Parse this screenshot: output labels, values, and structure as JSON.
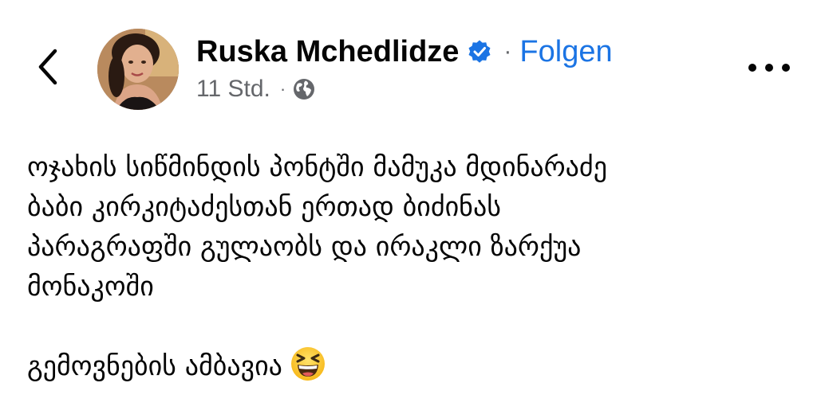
{
  "header": {
    "back_icon": "chevron-left-icon",
    "author_name": "Ruska Mchedlidze",
    "verified_icon": "verified-badge-icon",
    "separator": "·",
    "follow_label": "Folgen",
    "timestamp": "11 Std.",
    "meta_separator": "·",
    "audience_icon": "globe-icon",
    "more_icon": "more-options-icon"
  },
  "post": {
    "lines": [
      "ოჯახის სიწმინდის პონტში მამუკა მდინარაძე",
      "ბაბი კირკიტაძესთან ერთად ბიძინას",
      "პარაგრაფში გულაობს და ირაკლი ზარქუა",
      "მონაკოში"
    ],
    "closing_text": "გემოვნების ამბავია",
    "emoji": "grinning-squinting-face-emoji"
  },
  "colors": {
    "accent": "#1b74e4",
    "text_primary": "#050505",
    "text_secondary": "#65676b",
    "background": "#ffffff"
  }
}
